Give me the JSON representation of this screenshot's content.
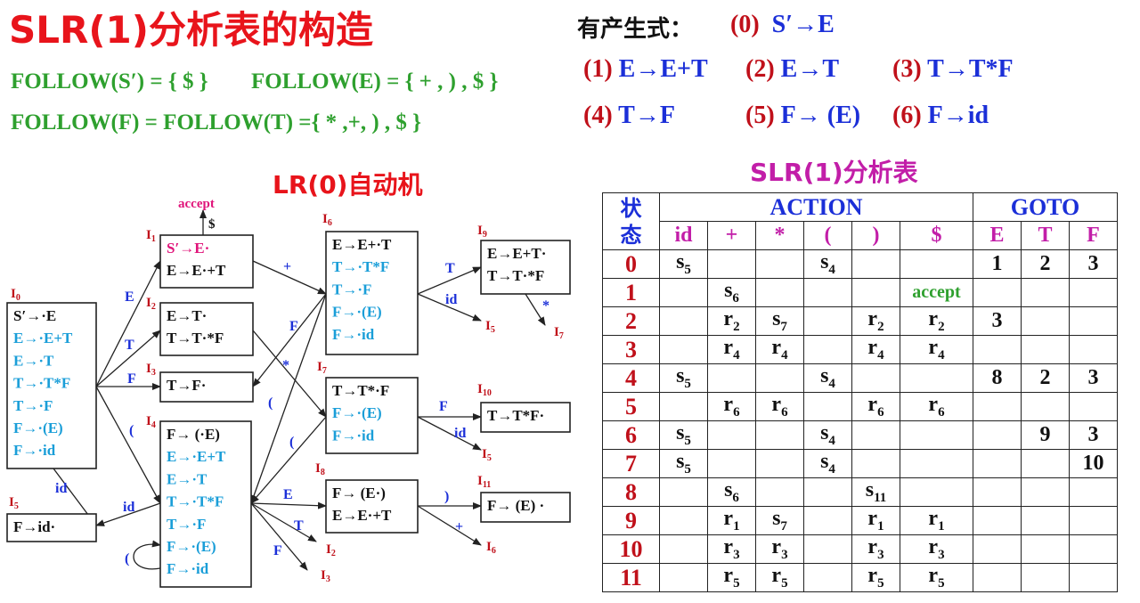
{
  "title": "SLR(1)分析表的构造",
  "follow": {
    "line1a": "FOLLOW(S′) = {  $ }",
    "line1b": "FOLLOW(E) = { + , ) , $ }",
    "line2": "FOLLOW(F) = FOLLOW(T) ={ * ,+, ) , $ }"
  },
  "productions": {
    "heading": "有产生式：",
    "items": [
      {
        "num": "(0)",
        "rule": "S′→E"
      },
      {
        "num": "(1)",
        "rule": "E→E+T"
      },
      {
        "num": "(2)",
        "rule": "E→T"
      },
      {
        "num": "(3)",
        "rule": "T→T*F"
      },
      {
        "num": "(4)",
        "rule": "T→F"
      },
      {
        "num": "(5)",
        "rule": "F→ (E)"
      },
      {
        "num": "(6)",
        "rule": "F→id"
      }
    ]
  },
  "automaton": {
    "title": "LR(0)自动机",
    "accept_label": "accept",
    "dollar_label": "$",
    "states": [
      {
        "id": "I0",
        "label": "I",
        "sub": "0",
        "items": [
          {
            "text": "S′→·E",
            "kernel": true
          },
          {
            "text": "E→·E+T",
            "kernel": false
          },
          {
            "text": "E→·T",
            "kernel": false
          },
          {
            "text": "T→·T*F",
            "kernel": false
          },
          {
            "text": "T→·F",
            "kernel": false
          },
          {
            "text": "F→·(E)",
            "kernel": false
          },
          {
            "text": "F→·id",
            "kernel": false
          }
        ]
      },
      {
        "id": "I1",
        "label": "I",
        "sub": "1",
        "items": [
          {
            "text": "S′→E·",
            "kernel": true,
            "accept": true
          },
          {
            "text": "E→E·+T",
            "kernel": true
          }
        ]
      },
      {
        "id": "I2",
        "label": "I",
        "sub": "2",
        "items": [
          {
            "text": "E→T·",
            "kernel": true
          },
          {
            "text": "T→T·*F",
            "kernel": true
          }
        ]
      },
      {
        "id": "I3",
        "label": "I",
        "sub": "3",
        "items": [
          {
            "text": "T→F·",
            "kernel": true
          }
        ]
      },
      {
        "id": "I4",
        "label": "I",
        "sub": "4",
        "items": [
          {
            "text": "F→ (·E)",
            "kernel": true
          },
          {
            "text": "E→·E+T",
            "kernel": false
          },
          {
            "text": "E→·T",
            "kernel": false
          },
          {
            "text": "T→·T*F",
            "kernel": false
          },
          {
            "text": "T→·F",
            "kernel": false
          },
          {
            "text": "F→·(E)",
            "kernel": false
          },
          {
            "text": "F→·id",
            "kernel": false
          }
        ]
      },
      {
        "id": "I5",
        "label": "I",
        "sub": "5",
        "items": [
          {
            "text": "F→id·",
            "kernel": true
          }
        ]
      },
      {
        "id": "I6",
        "label": "I",
        "sub": "6",
        "items": [
          {
            "text": "E→E+·T",
            "kernel": true
          },
          {
            "text": "T→·T*F",
            "kernel": false
          },
          {
            "text": "T→·F",
            "kernel": false
          },
          {
            "text": "F→·(E)",
            "kernel": false
          },
          {
            "text": "F→·id",
            "kernel": false
          }
        ]
      },
      {
        "id": "I7",
        "label": "I",
        "sub": "7",
        "items": [
          {
            "text": "T→T*·F",
            "kernel": true
          },
          {
            "text": "F→·(E)",
            "kernel": false
          },
          {
            "text": "F→·id",
            "kernel": false
          }
        ]
      },
      {
        "id": "I8",
        "label": "I",
        "sub": "8",
        "items": [
          {
            "text": "F→ (E·)",
            "kernel": true
          },
          {
            "text": "E→E·+T",
            "kernel": true
          }
        ]
      },
      {
        "id": "I9",
        "label": "I",
        "sub": "9",
        "items": [
          {
            "text": "E→E+T·",
            "kernel": true
          },
          {
            "text": "T→T·*F",
            "kernel": true
          }
        ]
      },
      {
        "id": "I10",
        "label": "I",
        "sub": "10",
        "items": [
          {
            "text": "T→T*F·",
            "kernel": true
          }
        ]
      },
      {
        "id": "I11",
        "label": "I",
        "sub": "11",
        "items": [
          {
            "text": "F→ (E) ·",
            "kernel": true
          }
        ]
      }
    ],
    "edge_labels": [
      {
        "id": "e0-1",
        "text": "E"
      },
      {
        "id": "e0-2",
        "text": "T"
      },
      {
        "id": "e0-3",
        "text": "F"
      },
      {
        "id": "e0-4",
        "text": "("
      },
      {
        "id": "e0-5",
        "text": "id"
      },
      {
        "id": "e1-6",
        "text": "+"
      },
      {
        "id": "e2-7",
        "text": "*"
      },
      {
        "id": "e4-5",
        "text": "id"
      },
      {
        "id": "e4-8",
        "text": "E"
      },
      {
        "id": "e4-2",
        "text": "T"
      },
      {
        "id": "e4-3",
        "text": "F"
      },
      {
        "id": "e4-4",
        "text": "("
      },
      {
        "id": "e6-9",
        "text": "T"
      },
      {
        "id": "e6-5",
        "text": "id"
      },
      {
        "id": "e6-3",
        "text": "F"
      },
      {
        "id": "e6-4",
        "text": "("
      },
      {
        "id": "e7-10",
        "text": "F"
      },
      {
        "id": "e7-5",
        "text": "id"
      },
      {
        "id": "e7-4",
        "text": "("
      },
      {
        "id": "e8-11",
        "text": ")"
      },
      {
        "id": "e8-6",
        "text": "+"
      },
      {
        "id": "e9-7",
        "text": "*"
      }
    ],
    "targets": [
      {
        "id": "t5a",
        "label": "I",
        "sub": "5"
      },
      {
        "id": "t7",
        "label": "I",
        "sub": "7"
      },
      {
        "id": "t5b",
        "label": "I",
        "sub": "5"
      },
      {
        "id": "t2",
        "label": "I",
        "sub": "2"
      },
      {
        "id": "t3",
        "label": "I",
        "sub": "3"
      },
      {
        "id": "t6",
        "label": "I",
        "sub": "6"
      }
    ]
  },
  "table": {
    "title": "SLR(1)分析表",
    "state_header_1": "状",
    "state_header_2": "态",
    "action_header": "ACTION",
    "goto_header": "GOTO",
    "action_symbols": [
      "id",
      "+",
      "*",
      "(",
      ")",
      "$"
    ],
    "goto_symbols": [
      "E",
      "T",
      "F"
    ],
    "rows": [
      {
        "state": "0",
        "cells": [
          [
            "s",
            "5"
          ],
          "",
          "",
          [
            "s",
            "4"
          ],
          "",
          "",
          "1",
          "2",
          "3"
        ]
      },
      {
        "state": "1",
        "cells": [
          "",
          [
            "s",
            "6"
          ],
          "",
          "",
          "",
          "accept",
          "",
          "",
          ""
        ]
      },
      {
        "state": "2",
        "cells": [
          "",
          [
            "r",
            "2"
          ],
          [
            "s",
            "7"
          ],
          "",
          [
            "r",
            "2"
          ],
          [
            "r",
            "2"
          ],
          "3",
          "",
          ""
        ]
      },
      {
        "state": "3",
        "cells": [
          "",
          [
            "r",
            "4"
          ],
          [
            "r",
            "4"
          ],
          "",
          [
            "r",
            "4"
          ],
          [
            "r",
            "4"
          ],
          "",
          "",
          ""
        ]
      },
      {
        "state": "4",
        "cells": [
          [
            "s",
            "5"
          ],
          "",
          "",
          [
            "s",
            "4"
          ],
          "",
          "",
          "8",
          "2",
          "3"
        ]
      },
      {
        "state": "5",
        "cells": [
          "",
          [
            "r",
            "6"
          ],
          [
            "r",
            "6"
          ],
          "",
          [
            "r",
            "6"
          ],
          [
            "r",
            "6"
          ],
          "",
          "",
          ""
        ]
      },
      {
        "state": "6",
        "cells": [
          [
            "s",
            "5"
          ],
          "",
          "",
          [
            "s",
            "4"
          ],
          "",
          "",
          "",
          "9",
          "3"
        ]
      },
      {
        "state": "7",
        "cells": [
          [
            "s",
            "5"
          ],
          "",
          "",
          [
            "s",
            "4"
          ],
          "",
          "",
          "",
          "",
          "10"
        ]
      },
      {
        "state": "8",
        "cells": [
          "",
          [
            "s",
            "6"
          ],
          "",
          "",
          [
            "s",
            "11"
          ],
          "",
          "",
          "",
          ""
        ]
      },
      {
        "state": "9",
        "cells": [
          "",
          [
            "r",
            "1"
          ],
          [
            "s",
            "7"
          ],
          "",
          [
            "r",
            "1"
          ],
          [
            "r",
            "1"
          ],
          "",
          "",
          ""
        ]
      },
      {
        "state": "10",
        "cells": [
          "",
          [
            "r",
            "3"
          ],
          [
            "r",
            "3"
          ],
          "",
          [
            "r",
            "3"
          ],
          [
            "r",
            "3"
          ],
          "",
          "",
          ""
        ]
      },
      {
        "state": "11",
        "cells": [
          "",
          [
            "r",
            "5"
          ],
          [
            "r",
            "5"
          ],
          "",
          [
            "r",
            "5"
          ],
          [
            "r",
            "5"
          ],
          "",
          "",
          ""
        ]
      }
    ]
  },
  "colors": {
    "title_red": "#e8141b",
    "follow_green": "#2ea02e",
    "state_red": "#c0101a",
    "rule_blue": "#1b2fd8",
    "closure_cyan": "#1a9ed8",
    "accept_magenta": "#e0147a",
    "symbol_magenta": "#c21ea8",
    "edge_blue": "#1b2fd8"
  }
}
